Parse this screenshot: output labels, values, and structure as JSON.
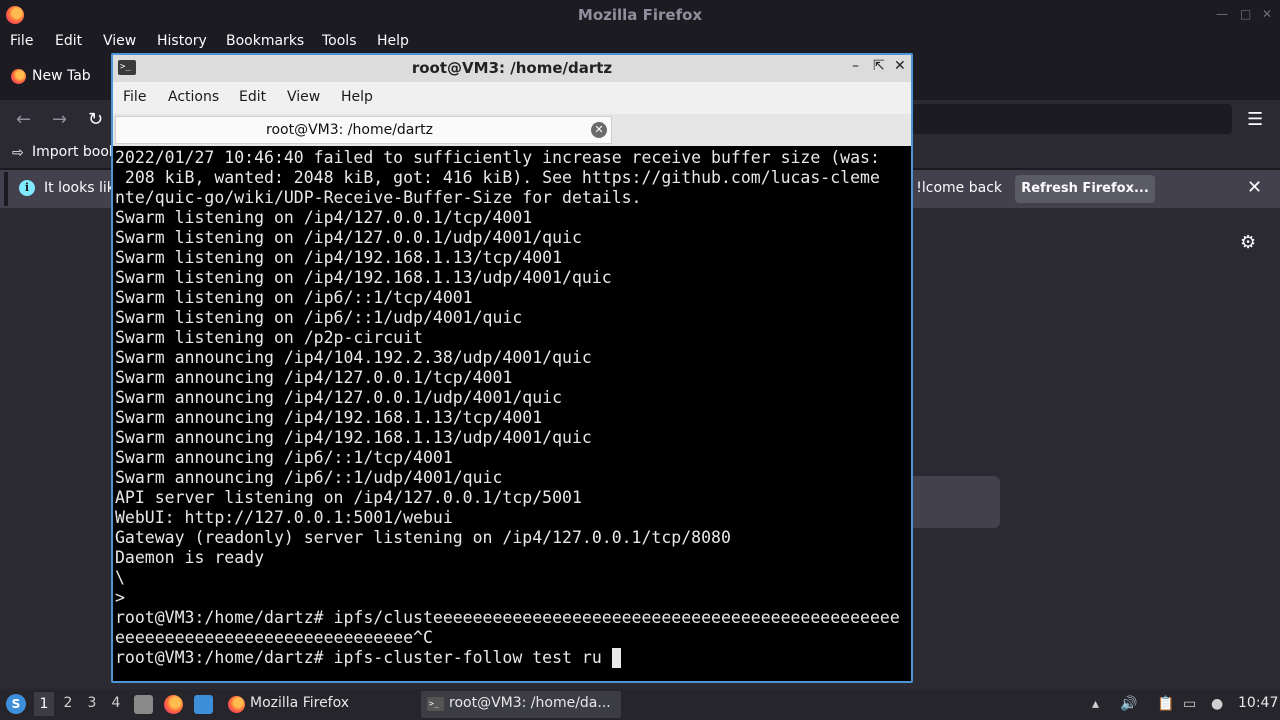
{
  "firefox": {
    "window_title": "Mozilla Firefox",
    "menu": [
      "File",
      "Edit",
      "View",
      "History",
      "Bookmarks",
      "Tools",
      "Help"
    ],
    "tab_label": "New Tab",
    "import_bookmarks_label": "Import book",
    "notification_text_left": "It looks lik",
    "notification_text_right": "lcome back!",
    "refresh_button_label": "Refresh Firefox..."
  },
  "terminal": {
    "window_title": "root@VM3: /home/dartz",
    "menu": [
      "File",
      "Actions",
      "Edit",
      "View",
      "Help"
    ],
    "tab_label": "root@VM3: /home/dartz",
    "lines": [
      "2022/01/27 10:46:40 failed to sufficiently increase receive buffer size (was:",
      " 208 kiB, wanted: 2048 kiB, got: 416 kiB). See https://github.com/lucas-cleme",
      "nte/quic-go/wiki/UDP-Receive-Buffer-Size for details.",
      "Swarm listening on /ip4/127.0.0.1/tcp/4001",
      "Swarm listening on /ip4/127.0.0.1/udp/4001/quic",
      "Swarm listening on /ip4/192.168.1.13/tcp/4001",
      "Swarm listening on /ip4/192.168.1.13/udp/4001/quic",
      "Swarm listening on /ip6/::1/tcp/4001",
      "Swarm listening on /ip6/::1/udp/4001/quic",
      "Swarm listening on /p2p-circuit",
      "Swarm announcing /ip4/104.192.2.38/udp/4001/quic",
      "Swarm announcing /ip4/127.0.0.1/tcp/4001",
      "Swarm announcing /ip4/127.0.0.1/udp/4001/quic",
      "Swarm announcing /ip4/192.168.1.13/tcp/4001",
      "Swarm announcing /ip4/192.168.1.13/udp/4001/quic",
      "Swarm announcing /ip6/::1/tcp/4001",
      "Swarm announcing /ip6/::1/udp/4001/quic",
      "API server listening on /ip4/127.0.0.1/tcp/5001",
      "WebUI: http://127.0.0.1:5001/webui",
      "Gateway (readonly) server listening on /ip4/127.0.0.1/tcp/8080",
      "Daemon is ready",
      "\\",
      ">",
      "root@VM3:/home/dartz# ipfs/clusteeeeeeeeeeeeeeeeeeeeeeeeeeeeeeeeeeeeeeeeeeeeeee",
      "eeeeeeeeeeeeeeeeeeeeeeeeeeeeee^C",
      "root@VM3:/home/dartz# ipfs-cluster-follow test ru"
    ]
  },
  "taskbar": {
    "workspaces": [
      "1",
      "2",
      "3",
      "4"
    ],
    "tasks": [
      "Mozilla Firefox",
      "root@VM3: /home/da..."
    ],
    "clock": "10:47"
  }
}
